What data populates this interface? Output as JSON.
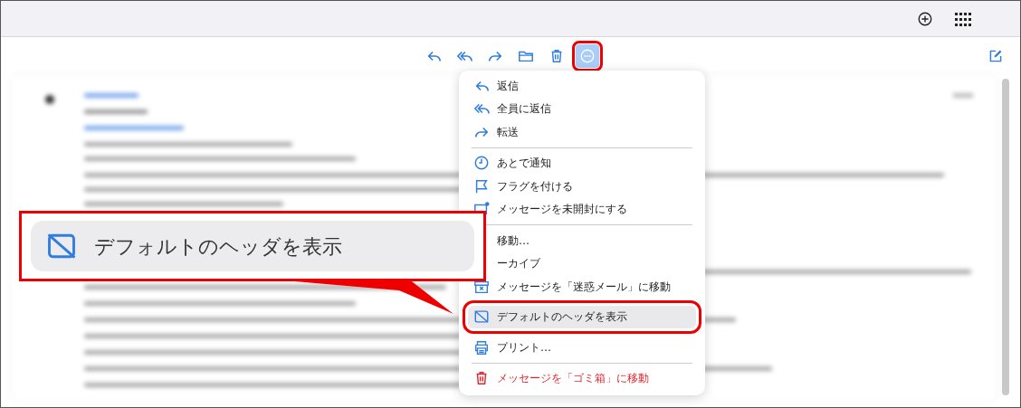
{
  "toolbar": {
    "buttons": [
      {
        "kind": "reply",
        "selected": false
      },
      {
        "kind": "reply-all",
        "selected": false
      },
      {
        "kind": "forward",
        "selected": false
      },
      {
        "kind": "folder",
        "selected": false
      },
      {
        "kind": "trash",
        "selected": false
      },
      {
        "kind": "more",
        "selected": true
      }
    ]
  },
  "menu": {
    "groups": [
      {
        "items": [
          {
            "kind": "reply",
            "label": "返信",
            "selected": false
          },
          {
            "kind": "reply-all",
            "label": "全員に返信",
            "selected": false
          },
          {
            "kind": "forward",
            "label": "転送",
            "selected": false
          }
        ]
      },
      {
        "items": [
          {
            "kind": "clock",
            "label": "あとで通知",
            "selected": false
          },
          {
            "kind": "flag",
            "label": "フラグを付ける",
            "selected": false
          },
          {
            "kind": "unread",
            "label": "メッセージを未開封にする",
            "selected": false
          }
        ]
      },
      {
        "items": [
          {
            "kind": "move",
            "label": "移動…",
            "selected": false
          },
          {
            "kind": "archive",
            "label": "ーカイブ",
            "selected": false
          },
          {
            "kind": "junk",
            "label": "メッセージを「迷惑メール」に移動",
            "selected": false
          },
          {
            "kind": "header",
            "label": "デフォルトのヘッダを表示",
            "selected": true
          },
          {
            "kind": "print",
            "label": "プリント…",
            "selected": false
          }
        ]
      },
      {
        "items": [
          {
            "kind": "delete",
            "label": "メッセージを「ゴミ箱」に移動",
            "selected": false
          }
        ]
      }
    ]
  },
  "callout": {
    "kind": "header",
    "label": "デフォルトのヘッダを表示"
  }
}
